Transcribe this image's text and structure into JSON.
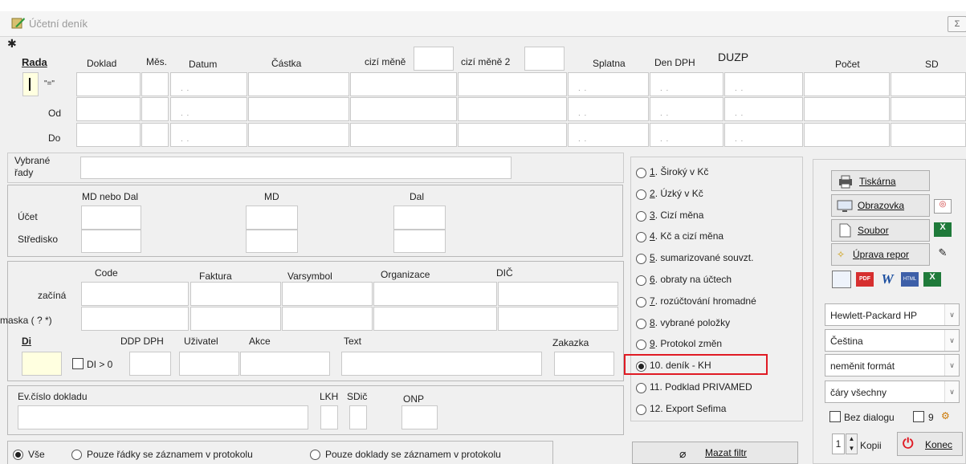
{
  "window": {
    "title": "Účetní deník",
    "close_glyph": "Σ"
  },
  "filter": {
    "rada_label": "Rada",
    "doklad_label": "Doklad",
    "mes_label": "Měs.",
    "datum_label": "Datum",
    "castka_label": "Částka",
    "cizi_mena_label": "cizí měně",
    "cizi_mena2_label": "cizí měně 2",
    "splatna_label": "Splatna",
    "den_dph_label": "Den DPH",
    "duzp_label": "DUZP",
    "pocet_label": "Počet",
    "sd_label": "SD",
    "row_eq": "\"=\"",
    "row_od": "Od",
    "row_do": "Do",
    "date_placeholder": ". ."
  },
  "vybrane": {
    "label_1": "Vybrané",
    "label_2": "řady",
    "value": ""
  },
  "ucet_group": {
    "md_nebo_dal": "MD nebo Dal",
    "md": "MD",
    "dal": "Dal",
    "ucet": "Účet",
    "stredisko": "Středisko"
  },
  "code_group": {
    "code": "Code",
    "faktura": "Faktura",
    "varsymbol": "Varsymbol",
    "organizace": "Organizace",
    "dic": "DIČ",
    "zacina": "začíná",
    "maska": "maska ( ? *)"
  },
  "di_group": {
    "di": "Di",
    "di_gt0": "DI > 0",
    "ddp_dph": "DDP DPH",
    "uzivatel": "Uživatel",
    "akce": "Akce",
    "text": "Text",
    "zakazka": "Zakazka"
  },
  "ev_group": {
    "ev_cislo": "Ev.číslo dokladu",
    "lkh": "LKH",
    "sdic": "SDič",
    "onp": "ONP"
  },
  "reports": [
    {
      "key": "1",
      "label": " Široký v Kč",
      "selected": false
    },
    {
      "key": "2",
      "label": " Úzký v Kč",
      "selected": false
    },
    {
      "key": "3",
      "label": " Cizí měna",
      "selected": false
    },
    {
      "key": "4",
      "label": " Kč a cizí měna",
      "selected": false
    },
    {
      "key": "5",
      "label": " sumarizované souvzt.",
      "selected": false
    },
    {
      "key": "6",
      "label": " obraty na účtech",
      "selected": false
    },
    {
      "key": "7",
      "label": " rozúčtování hromadné",
      "selected": false
    },
    {
      "key": "8",
      "label": " vybrané položky",
      "selected": false
    },
    {
      "key": "9",
      "label": " Protokol změn",
      "selected": false
    },
    {
      "key": "",
      "label": "10. deník - KH",
      "selected": true
    },
    {
      "key": "",
      "label": "11. Podklad PRIVAMED",
      "selected": false
    },
    {
      "key": "",
      "label": "12. Export Sefima",
      "selected": false
    }
  ],
  "scope": {
    "vse": "Vše",
    "pouze_radky": "Pouze řádky se záznamem v protokolu",
    "pouze_doklady": "Pouze doklady se záznamem v protokolu"
  },
  "actions": {
    "mazat_filtr": "Mazat filtr",
    "tiskarna": "Tiskárna",
    "obrazovka": "Obrazovka",
    "soubor": "Soubor",
    "uprava": "Úprava repor",
    "konec": "Konec",
    "kopii": "Kopii",
    "copies": "1"
  },
  "combos": {
    "printer": "Hewlett-Packard HP",
    "language": "Čeština",
    "format": "neměnit formát",
    "lines": "čáry všechny"
  },
  "bez_dialogu": "Bez dialogu",
  "nine": "9",
  "colors": {
    "highlight": "#e01b24",
    "yellow_field": "#ffffe0"
  }
}
